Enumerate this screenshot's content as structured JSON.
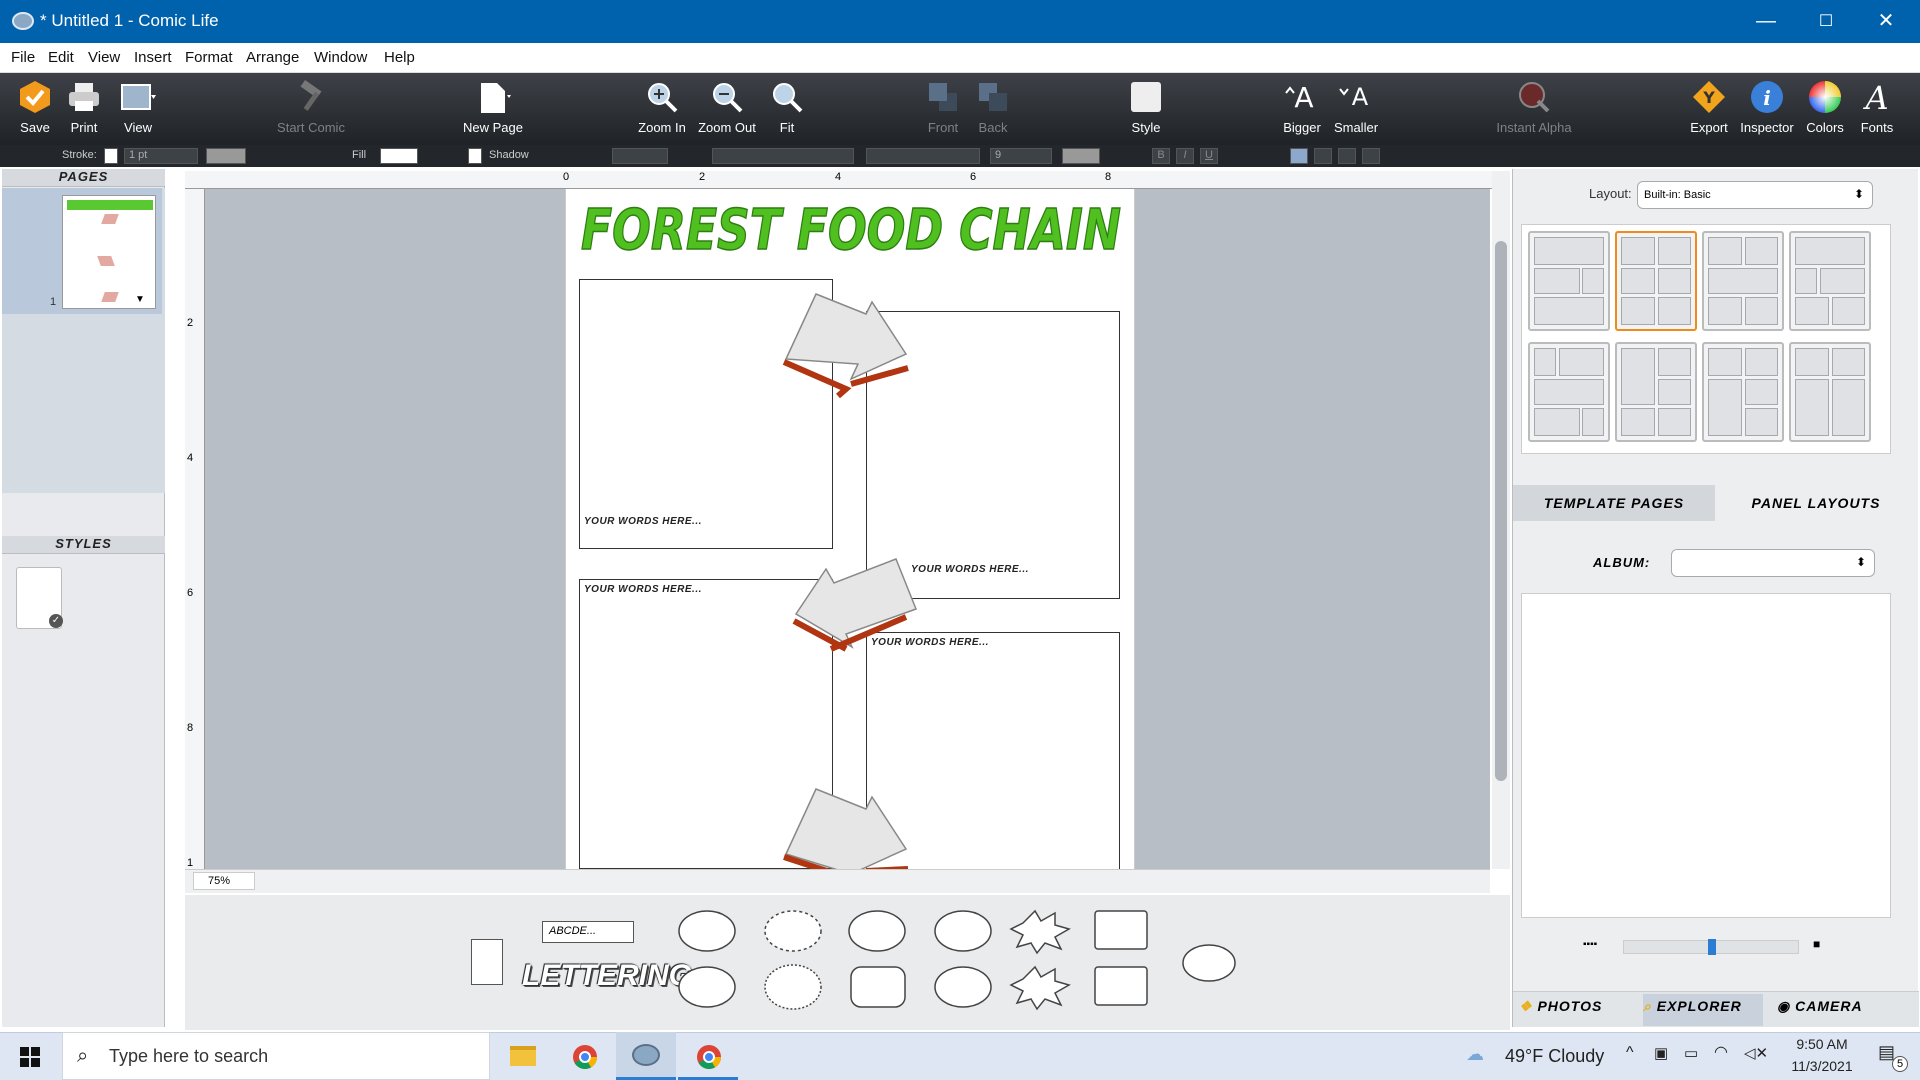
{
  "window": {
    "title": "* Untitled 1 - Comic Life",
    "controls": {
      "minimize": "—",
      "maximize": "☐",
      "close": "✕"
    }
  },
  "menu": [
    "File",
    "Edit",
    "View",
    "Insert",
    "Format",
    "Arrange",
    "Window",
    "Help"
  ],
  "toolbar": {
    "save": "Save",
    "print": "Print",
    "view": "View",
    "start_comic": "Start Comic",
    "new_page": "New Page",
    "zoom_in": "Zoom In",
    "zoom_out": "Zoom Out",
    "fit": "Fit",
    "front": "Front",
    "back": "Back",
    "style": "Style",
    "bigger": "Bigger",
    "smaller": "Smaller",
    "instant_alpha": "Instant Alpha",
    "export": "Export",
    "inspector": "Inspector",
    "colors": "Colors",
    "fonts": "Fonts"
  },
  "format_bar": {
    "stroke_label": "Stroke:",
    "stroke_value": "1 pt",
    "fill_label": "Fill",
    "shadow_label": "Shadow",
    "font_size": "9",
    "bold": "B",
    "italic": "I",
    "underline": "U"
  },
  "left_pane": {
    "pages_header": "PAGES",
    "page_number": "1",
    "styles_header": "STYLES"
  },
  "ruler": {
    "h_ticks": [
      "0",
      "2",
      "4",
      "6",
      "8"
    ],
    "v_ticks": [
      "2",
      "4",
      "6",
      "8",
      "1"
    ]
  },
  "page": {
    "title": "FOREST FOOD CHAIN",
    "caption": "YOUR WORDS HERE..."
  },
  "status": {
    "zoom": "75%"
  },
  "right_pane": {
    "layout_label": "Layout:",
    "layout_value": "Built-in: Basic",
    "tab_template": "TEMPLATE PAGES",
    "tab_panel": "PANEL LAYOUTS",
    "album_label": "ALBUM:",
    "tab_photos": "PHOTOS",
    "tab_explorer": "EXPLORER",
    "tab_camera": "CAMERA",
    "slider_value": 0.5
  },
  "shapes": {
    "text_box": "ABCDE...",
    "lettering": "LETTERING"
  },
  "taskbar": {
    "search_placeholder": "Type here to search",
    "weather": "49°F  Cloudy",
    "time": "9:50 AM",
    "date": "11/3/2021",
    "notifications": "5"
  },
  "colors": {
    "titlebar": "#0062ad",
    "accent": "#f08a1c",
    "title_green": "#4fc020"
  }
}
